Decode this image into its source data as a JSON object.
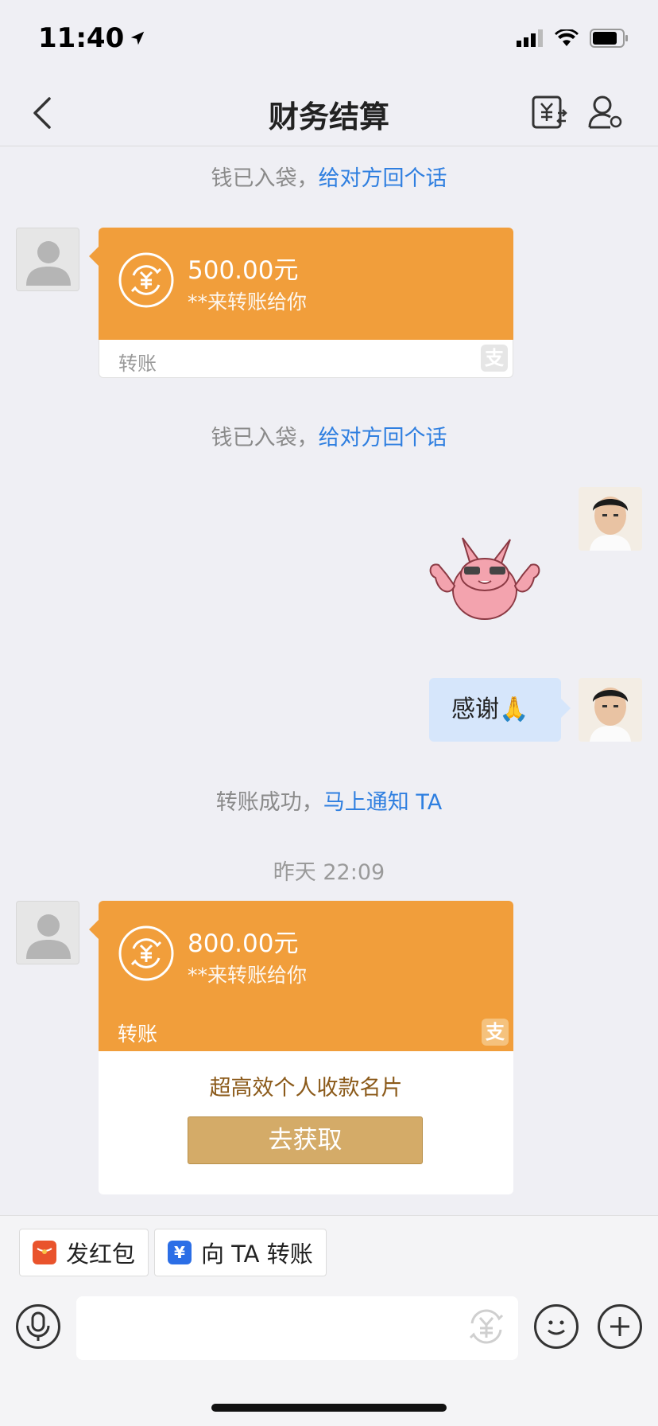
{
  "status_bar": {
    "time": "11:40"
  },
  "nav": {
    "title": "财务结算"
  },
  "messages": {
    "notice1": {
      "text": "钱已入袋，",
      "link": "给对方回个话"
    },
    "card1": {
      "amount": "500.00元",
      "subtitle": "**来转账给你",
      "label": "转账"
    },
    "notice2": {
      "text": "钱已入袋，",
      "link": "给对方回个话"
    },
    "self_message": "感谢🙏",
    "notice3": {
      "text": "转账成功，",
      "link": "马上通知 TA"
    },
    "timestamp": "昨天 22:09",
    "card2": {
      "amount": "800.00元",
      "subtitle": "**来转账给你",
      "label": "转账",
      "promo_text": "超高效个人收款名片",
      "promo_button": "去获取"
    }
  },
  "quick_actions": {
    "red_packet": "发红包",
    "transfer": "向 TA 转账"
  },
  "colors": {
    "card_orange": "#f19e3b",
    "link_blue": "#2f7fe0",
    "self_bubble": "#d6e6fb",
    "promo_button": "#d4ab68"
  }
}
